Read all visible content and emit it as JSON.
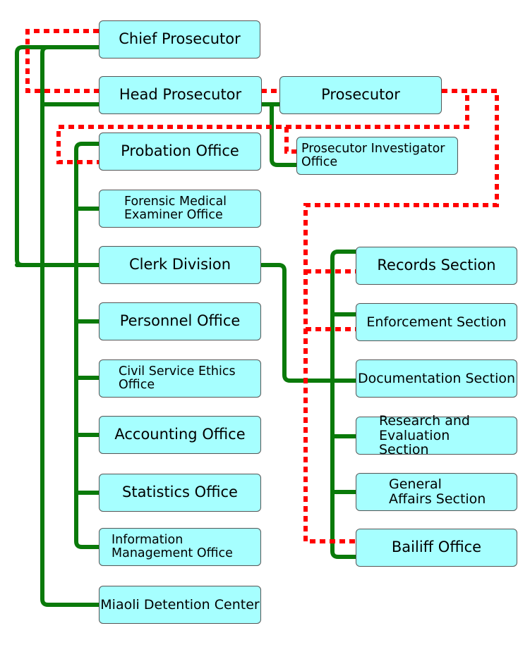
{
  "diagram": {
    "type": "org-chart",
    "legend": {
      "solid_line": "direct reporting line",
      "dotted_line": "supervisory relationship"
    },
    "colors": {
      "box_fill": "#a6ffff",
      "box_border": "#555555",
      "solid_line": "#0a7a0a",
      "dotted_line": "#ff0000"
    },
    "nodes": {
      "chief_prosecutor": "Chief Prosecutor",
      "head_prosecutor": "Head Prosecutor",
      "prosecutor": "Prosecutor",
      "prosecutor_investigator_office": "Prosecutor Investigator Office",
      "probation_office": "Probation Office",
      "forensic_medical_examiner_office": "Forensic Medical Examiner Office",
      "clerk_division": "Clerk Division",
      "personnel_office": "Personnel Office",
      "civil_service_ethics_office": "Civil Service Ethics Office",
      "accounting_office": "Accounting Office",
      "statistics_office": "Statistics Office",
      "information_management_office": "Information Management Office",
      "miaoli_detention_center": "Miaoli Detention Center",
      "records_section": "Records Section",
      "enforcement_section": "Enforcement Section",
      "documentation_section": "Documentation Section",
      "research_and_evaluation_section": "Research and Evaluation Section",
      "general_affairs_section": "General Affairs Section",
      "bailiff_office": "Bailiff Office"
    },
    "edges_solid": [
      [
        "chief_prosecutor",
        "head_prosecutor"
      ],
      [
        "chief_prosecutor",
        "probation_office"
      ],
      [
        "chief_prosecutor",
        "forensic_medical_examiner_office"
      ],
      [
        "chief_prosecutor",
        "clerk_division"
      ],
      [
        "chief_prosecutor",
        "personnel_office"
      ],
      [
        "chief_prosecutor",
        "civil_service_ethics_office"
      ],
      [
        "chief_prosecutor",
        "accounting_office"
      ],
      [
        "chief_prosecutor",
        "statistics_office"
      ],
      [
        "chief_prosecutor",
        "information_management_office"
      ],
      [
        "chief_prosecutor",
        "miaoli_detention_center"
      ],
      [
        "head_prosecutor",
        "prosecutor"
      ],
      [
        "head_prosecutor",
        "prosecutor_investigator_office"
      ],
      [
        "clerk_division",
        "records_section"
      ],
      [
        "clerk_division",
        "enforcement_section"
      ],
      [
        "clerk_division",
        "documentation_section"
      ],
      [
        "clerk_division",
        "research_and_evaluation_section"
      ],
      [
        "clerk_division",
        "general_affairs_section"
      ],
      [
        "clerk_division",
        "bailiff_office"
      ]
    ],
    "edges_dotted": [
      [
        "chief_prosecutor",
        "head_prosecutor"
      ],
      [
        "head_prosecutor",
        "prosecutor"
      ],
      [
        "prosecutor",
        "probation_office"
      ],
      [
        "prosecutor",
        "prosecutor_investigator_office"
      ],
      [
        "prosecutor",
        "records_section"
      ],
      [
        "prosecutor",
        "enforcement_section"
      ],
      [
        "prosecutor",
        "bailiff_office"
      ]
    ]
  }
}
